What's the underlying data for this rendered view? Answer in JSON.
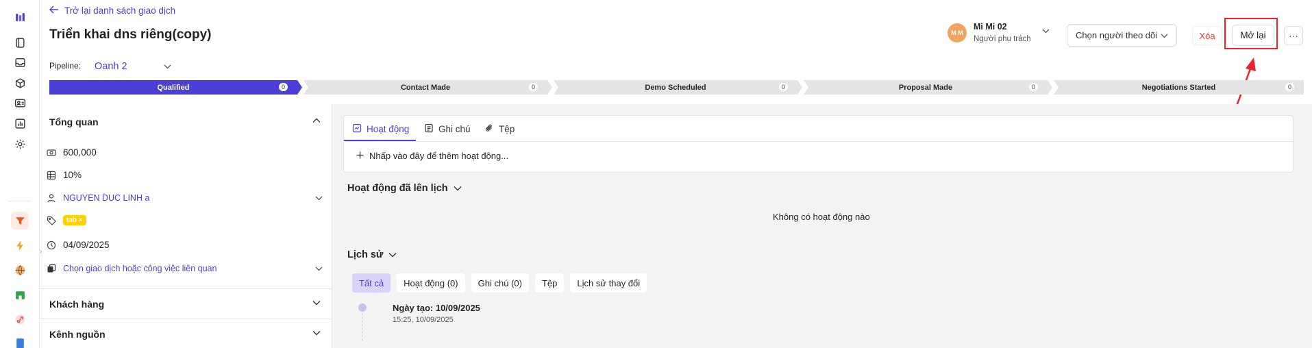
{
  "header": {
    "back_label": "Trở lại danh sách giao dịch",
    "title": "Triển khai dns riêng(copy)",
    "pipeline_label": "Pipeline:",
    "pipeline_value": "Oanh 2",
    "owner": {
      "initials": "M M",
      "name": "Mi Mi 02",
      "role": "Người phụ trách"
    },
    "follower_placeholder": "Chọn người theo dõi",
    "delete_label": "Xóa",
    "reopen_label": "Mở lại",
    "more_label": "···"
  },
  "stages": [
    {
      "label": "Qualified",
      "count": "0",
      "active": true
    },
    {
      "label": "Contact Made",
      "count": "0",
      "active": false
    },
    {
      "label": "Demo Scheduled",
      "count": "0",
      "active": false
    },
    {
      "label": "Proposal Made",
      "count": "0",
      "active": false
    },
    {
      "label": "Negotiations Started",
      "count": "0",
      "active": false
    }
  ],
  "overview": {
    "title": "Tổng quan",
    "value": "600,000",
    "probability": "10%",
    "person": "NGUYEN DUC LINH a",
    "tag": "tab",
    "tag_remove": "×",
    "date": "04/09/2025",
    "related_placeholder": "Chọn giao dịch hoặc công việc liên quan"
  },
  "sections": {
    "customer": "Khách hàng",
    "source": "Kênh nguồn"
  },
  "tabs": [
    {
      "label": "Hoạt động",
      "icon": "activity-icon"
    },
    {
      "label": "Ghi chú",
      "icon": "note-icon"
    },
    {
      "label": "Tệp",
      "icon": "paperclip-icon"
    }
  ],
  "add_activity": "Nhấp vào đây để thêm hoạt động...",
  "scheduled": {
    "title": "Hoạt động đã lên lịch",
    "empty": "Không có hoạt động nào"
  },
  "history": {
    "title": "Lịch sử",
    "filters": [
      "Tất cả",
      "Hoạt động (0)",
      "Ghi chú (0)",
      "Tệp",
      "Lịch sử thay đổi"
    ],
    "entries": [
      {
        "title": "Ngày tạo: 10/09/2025",
        "time": "15:25, 10/09/2025"
      }
    ]
  },
  "colors": {
    "accent": "#4b3fd6",
    "danger": "#e03a3a",
    "tag": "#ffd100",
    "annotation": "#e8232a"
  }
}
